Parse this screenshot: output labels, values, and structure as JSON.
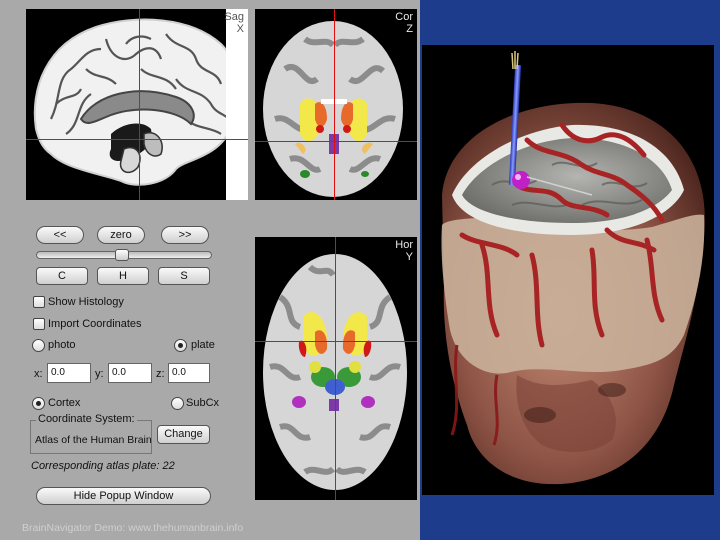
{
  "views": {
    "sagittal": {
      "label_top": "Sag",
      "label_bottom": "X"
    },
    "coronal": {
      "label_top": "Cor",
      "label_bottom": "Z"
    },
    "horizontal": {
      "label_top": "Hor",
      "label_bottom": "Y"
    }
  },
  "nav": {
    "prev": "<<",
    "zero": "zero",
    "next": ">>"
  },
  "planes": {
    "c": "C",
    "h": "H",
    "s": "S"
  },
  "options": {
    "show_histology": "Show Histology",
    "import_coordinates": "Import Coordinates",
    "photo": "photo",
    "plate": "plate",
    "plate_selected": true
  },
  "coords": {
    "x_label": "x:",
    "x_value": "0.0",
    "y_label": "y:",
    "y_value": "0.0",
    "z_label": "z:",
    "z_value": "0.0"
  },
  "region": {
    "cortex": "Cortex",
    "subcx": "SubCx",
    "cortex_selected": true
  },
  "coordinate_system": {
    "title": "Coordinate System:",
    "value": "Atlas of the Human Brain",
    "change": "Change"
  },
  "plate_text": "Corresponding atlas plate: 22",
  "hide_popup": "Hide Popup Window",
  "footer": "BrainNavigator Demo:   www.thehumanbrain.info",
  "colors": {
    "panel": "#a9a9a9",
    "right_bg": "#1e3c8c",
    "crosshair": "#e01010"
  }
}
